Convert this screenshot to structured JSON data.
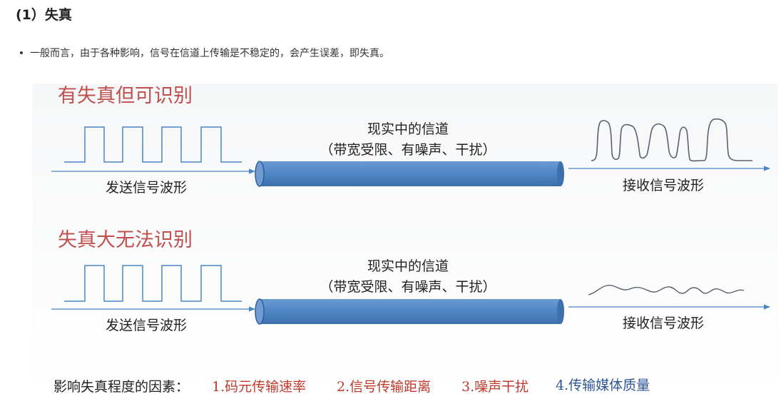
{
  "page": {
    "heading": "(1）失真",
    "bullet": "一般而言，由于各种影响，信号在信道上传输是不稳定的，会产生误差，即失真。"
  },
  "figure": {
    "colors": {
      "title": "#c0504d",
      "line": "#4a86c5",
      "pipe": "#4f86c6",
      "wave": "#5a6270",
      "factor_red": "#c0392b",
      "factor_blue": "#2f5597"
    },
    "panels": [
      {
        "title": "有失真但可识别",
        "channel_line1": "现实中的信道",
        "channel_line2": "（带宽受限、有噪声、干扰）",
        "send_label": "发送信号波形",
        "recv_label": "接收信号波形"
      },
      {
        "title": "失真大无法识别",
        "channel_line1": "现实中的信道",
        "channel_line2": "（带宽受限、有噪声、干扰）",
        "send_label": "发送信号波形",
        "recv_label": "接收信号波形"
      }
    ],
    "factors": {
      "prefix": "影响失真程度的因素：",
      "items": [
        "1.码元传输速率",
        "2.信号传输距离",
        "3.噪声干扰",
        "4.传输媒体质量"
      ]
    }
  }
}
